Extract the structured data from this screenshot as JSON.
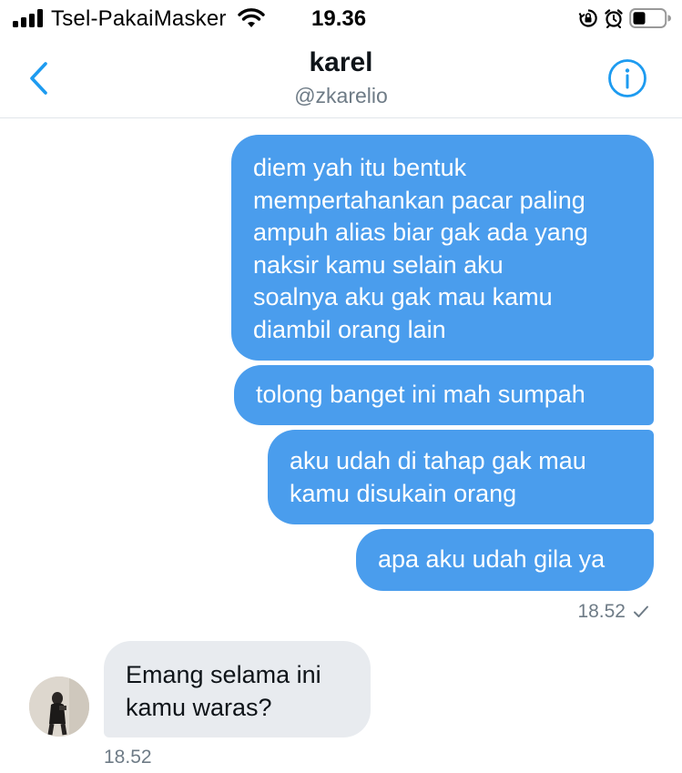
{
  "status_bar": {
    "carrier": "Tsel-PakaiMasker",
    "time": "19.36",
    "icons": [
      "signal-icon",
      "wifi-icon",
      "rotation-lock-icon",
      "alarm-icon",
      "battery-icon"
    ]
  },
  "header": {
    "name": "karel",
    "handle": "@zkarelio",
    "back_icon": "chevron-left-icon",
    "info_icon": "info-icon"
  },
  "messages": {
    "sent": [
      {
        "text": "diem yah itu bentuk\nmempertahankan pacar paling\nampuh alias biar gak ada yang\nnaksir kamu selain aku\nsoalnya aku gak mau kamu\ndiambil orang lain"
      },
      {
        "text": "tolong banget ini mah sumpah"
      },
      {
        "text": "aku udah di tahap gak mau\nkamu disukain orang"
      },
      {
        "text": "apa aku udah gila ya"
      }
    ],
    "sent_time": "18.52",
    "sent_status_icon": "checkmark-icon",
    "received": [
      {
        "text": "Emang selama ini\nkamu waras?"
      }
    ],
    "received_time": "18.52"
  },
  "colors": {
    "sent_bubble": "#4a9ded",
    "received_bubble": "#e8ebef",
    "accent": "#1d9bf0",
    "secondary_text": "#6e7b86"
  }
}
